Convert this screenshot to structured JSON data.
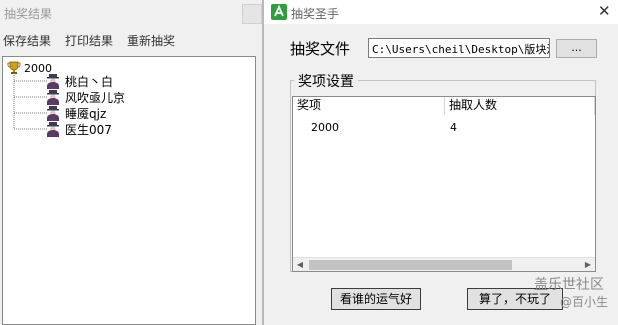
{
  "background_window": {
    "title": "抽奖结果",
    "menu": [
      "保存结果",
      "打印结果",
      "重新抽奖"
    ],
    "tree": {
      "root_label": "2000",
      "children": [
        "桃白丶白",
        "风吹亟儿京",
        "睡魇qjz",
        "医生007"
      ]
    }
  },
  "dialog": {
    "title": "抽奖圣手",
    "close_glyph": "✕",
    "file_label": "抽奖文件",
    "file_path": "C:\\Users\\cheil\\Desktop\\版块活",
    "browse_label": "...",
    "group_title": "奖项设置",
    "list": {
      "columns": [
        "奖项",
        "抽取人数"
      ],
      "rows": [
        [
          "2000",
          "4"
        ]
      ]
    },
    "buttons": {
      "luck": "看谁的运气好",
      "quit": "算了，不玩了"
    }
  },
  "watermark": {
    "line1": "盖乐世社区",
    "line2": "@百小生"
  },
  "colors": {
    "window_bg": "#f0f0f0",
    "list_bg": "#ffffff",
    "border": "#8a8a8a",
    "app_icon_green": "#2e9e3e"
  },
  "icons": [
    "trophy-icon",
    "person-icon",
    "app-logo-icon",
    "close-icon",
    "scroll-left-icon",
    "scroll-right-icon"
  ]
}
